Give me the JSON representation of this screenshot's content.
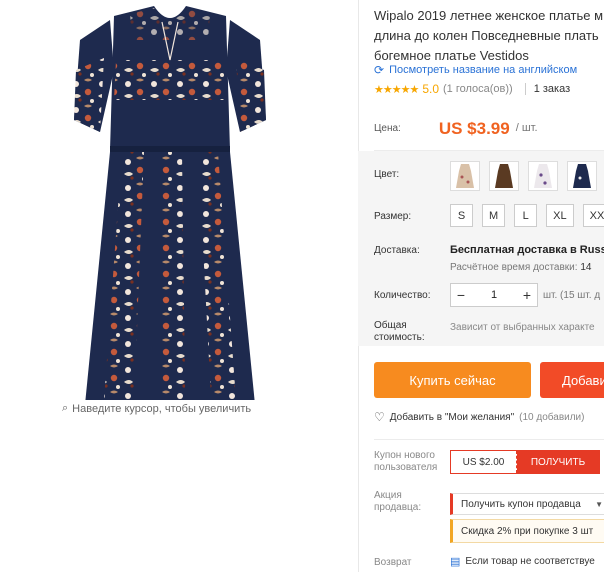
{
  "gallery": {
    "zoom_hint": "Наведите курсор, чтобы увеличить"
  },
  "product": {
    "title_lines": [
      "Wipalo 2019 летнее женское платье м",
      "длина до колен Повседневные плать",
      "богемное платье Vestidos"
    ],
    "translate_link": "Посмотреть название на английском",
    "rating_stars": "★★★★★",
    "rating_score": "5.0",
    "rating_votes": "(1 голоса(ов))",
    "orders": "1 заказ"
  },
  "price": {
    "label": "Цена:",
    "value": "US $3.99",
    "unit": "/ шт."
  },
  "options": {
    "color_label": "Цвет:",
    "color_swatches": [
      "beige-floral-dress",
      "brown-dress",
      "white-floral-dress",
      "navy-floral-dress"
    ],
    "size_label": "Размер:",
    "sizes": [
      "S",
      "M",
      "L",
      "XL",
      "XXL"
    ],
    "shipping_label": "Доставка:",
    "shipping_main": "Бесплатная доставка в Russia",
    "shipping_sub_prefix": "Расчётное время доставки:",
    "shipping_sub_value": "14",
    "quantity_label": "Количество:",
    "quantity_minus": "−",
    "quantity_value": "1",
    "quantity_plus": "+",
    "quantity_note": "шт. (15 шт. д",
    "total_label_1": "Общая",
    "total_label_2": "стоимость:",
    "total_value": "Зависит от выбранных характе"
  },
  "actions": {
    "buy_now": "Купить сейчас",
    "add_to_cart": "Добавить",
    "wishlist": "Добавить в \"Мои желания\"",
    "wishlist_count": "(10 добавили)"
  },
  "coupon": {
    "label_1": "Купон нового",
    "label_2": "пользователя",
    "amount": "US $2.00",
    "get_button": "ПОЛУЧИТЬ"
  },
  "promo": {
    "label_1": "Акция",
    "label_2": "продавца:",
    "dropdown": "Получить купон продавца",
    "discount": "Скидка 2% при покупке 3 шт"
  },
  "returns": {
    "label": "Возврат",
    "value": "Если товар не соответствуе"
  },
  "colors": {
    "accent_orange": "#f78b1f",
    "price_orange": "#f06321",
    "cart_red": "#f24b27",
    "coupon_red": "#e53a25",
    "link_blue": "#2a72d6",
    "star_gold": "#f7a600"
  }
}
